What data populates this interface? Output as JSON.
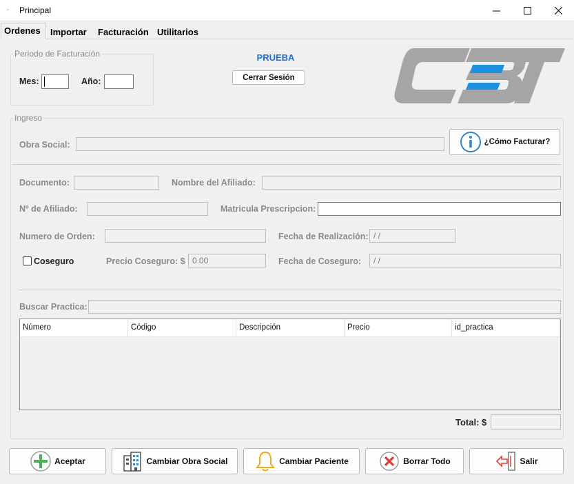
{
  "window": {
    "title": "Principal",
    "controls": {
      "minimize": "—",
      "maximize": "☐",
      "close": "✕"
    }
  },
  "tabs": [
    {
      "label": "Ordenes",
      "active": true
    },
    {
      "label": "Importar",
      "active": false
    },
    {
      "label": "Facturación",
      "active": false
    },
    {
      "label": "Utilitarios",
      "active": false
    }
  ],
  "periodo": {
    "group_label": "Periodo de Facturación",
    "mes_label": "Mes:",
    "mes_value": "",
    "anio_label": "Año:",
    "anio_value": ""
  },
  "session": {
    "user": "PRUEBA",
    "logout_label": "Cerrar Sesión",
    "user_color": "#1e6fd9"
  },
  "logo": {
    "text": "CBT",
    "gray": "#a5a5a5",
    "blue": "#1e90e0"
  },
  "ingreso": {
    "group_label": "Ingreso",
    "obra_social_label": "Obra Social:",
    "obra_social_value": "",
    "como_facturar_label": "¿Cómo Facturar?",
    "documento_label": "Documento:",
    "documento_value": "",
    "nombre_afiliado_label": "Nombre del Afiliado:",
    "nombre_afiliado_value": "",
    "nro_afiliado_label": "Nº de Afiliado:",
    "nro_afiliado_value": "",
    "matricula_label": "Matricula Prescripcion:",
    "matricula_value": "",
    "numero_orden_label": "Numero de Orden:",
    "numero_orden_value": "",
    "fecha_realizacion_label": "Fecha de Realización:",
    "fecha_realizacion_value": " /  /",
    "coseguro_label": "Coseguro",
    "coseguro_checked": false,
    "precio_coseguro_label": "Precio Coseguro: $",
    "precio_coseguro_value": "0.00",
    "fecha_coseguro_label": "Fecha de Coseguro:",
    "fecha_coseguro_value": " /  /",
    "buscar_practica_label": "Buscar Practica:",
    "buscar_practica_value": ""
  },
  "grid": {
    "columns": [
      "Número",
      "Código",
      "Descripción",
      "Precio",
      "id_practica"
    ],
    "rows": []
  },
  "total": {
    "label": "Total: $",
    "value": ""
  },
  "buttons": {
    "aceptar": "Aceptar",
    "cambiar_obra_social": "Cambiar Obra Social",
    "cambiar_paciente": "Cambiar Paciente",
    "borrar_todo": "Borrar Todo",
    "salir": "Salir"
  },
  "colors": {
    "accent_green": "#4caf50",
    "accent_red": "#e53935",
    "accent_orange": "#f5a623",
    "info_blue": "#2f86c9"
  }
}
